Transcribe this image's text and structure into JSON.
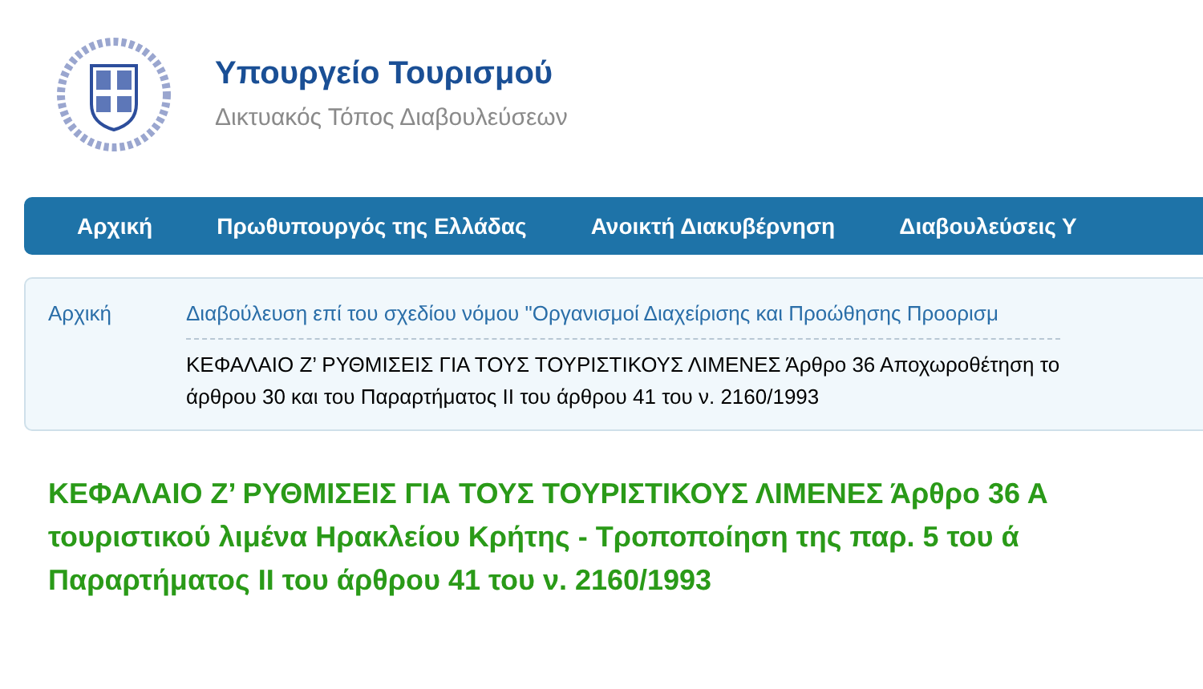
{
  "header": {
    "title": "Υπουργείο Τουρισμού",
    "subtitle": "Δικτυακός Τόπος Διαβουλεύσεων"
  },
  "nav": [
    {
      "label": "Αρχική"
    },
    {
      "label": "Πρωθυπουργός της Ελλάδας"
    },
    {
      "label": "Ανοικτή Διακυβέρνηση"
    },
    {
      "label": "Διαβουλεύσεις Υ"
    }
  ],
  "breadcrumb": {
    "home": "Αρχική",
    "link": "Διαβούλευση επί του σχεδίου νόμου \"Οργανισμοί Διαχείρισης και Προώθησης Προορισμ",
    "current_lines": [
      "ΚΕΦΑΛΑΙΟ Ζ’ ΡΥΘΜΙΣΕΙΣ ΓΙΑ ΤΟΥΣ ΤΟΥΡΙΣΤΙΚΟΥΣ ΛΙΜΕΝΕΣ Άρθρο 36 Αποχωροθέτηση το",
      "άρθρου 30 και του Παραρτήματος ΙΙ του άρθρου 41 του ν. 2160/1993"
    ]
  },
  "heading_lines": [
    "ΚΕΦΑΛΑΙΟ Ζ’ ΡΥΘΜΙΣΕΙΣ ΓΙΑ ΤΟΥΣ ΤΟΥΡΙΣΤΙΚΟΥΣ ΛΙΜΕΝΕΣ Άρθρο 36 Α",
    "τουριστικού λιμένα Ηρακλείου Κρήτης - Τροποποίηση της παρ. 5 του ά",
    "Παραρτήματος ΙΙ του άρθρου 41 του ν. 2160/1993"
  ]
}
